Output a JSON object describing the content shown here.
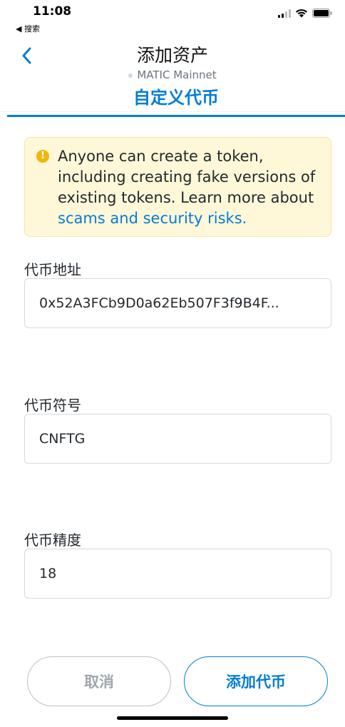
{
  "status_bar": {
    "time": "11:08",
    "back_label": "◀ 搜索",
    "icons": [
      "signal-icon",
      "wifi-icon",
      "battery-icon"
    ]
  },
  "nav": {
    "title": "添加资产",
    "network": "MATIC Mainnet"
  },
  "tab": {
    "label": "自定义代币"
  },
  "warning": {
    "text": "Anyone can create a token, including creating fake versions of existing tokens. Learn more about ",
    "link": "scams and security risks."
  },
  "fields": {
    "address": {
      "label": "代币地址",
      "value": "0x52A3FCb9D0a62Eb507F3f9B4F..."
    },
    "symbol": {
      "label": "代币符号",
      "value": "CNFTG"
    },
    "decimals": {
      "label": "代币精度",
      "value": "18"
    }
  },
  "buttons": {
    "cancel": "取消",
    "add": "添加代币"
  },
  "colors": {
    "accent": "#037dd6",
    "warning_bg": "#fef7d8",
    "warning_icon": "#f0b60b",
    "muted": "#9fa6ae"
  }
}
